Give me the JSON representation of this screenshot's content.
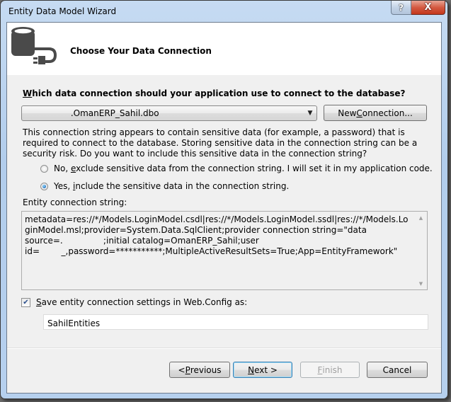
{
  "window": {
    "title": "Entity Data Model Wizard",
    "help_label": "?",
    "close_label": "X"
  },
  "header": {
    "icon": "database-connection-icon",
    "title": "Choose Your Data Connection"
  },
  "connection": {
    "question_accesskey": "W",
    "question_rest": "hich data connection should your application use to connect to the database?",
    "selected_value": "                 .OmanERP_Sahil.dbo",
    "dropdown_icon": "chevron-down-icon",
    "new_connection_prefix": "New ",
    "new_connection_accesskey": "C",
    "new_connection_rest": "onnection..."
  },
  "sensitive": {
    "info": "This connection string appears to contain sensitive data (for example, a password) that is required to connect to the database. Storing sensitive data in the connection string can be a security risk. Do you want to include this sensitive data in the connection string?",
    "options": [
      {
        "prefix": "No, ",
        "accesskey": "e",
        "rest": "xclude sensitive data from the connection string. I will set it in my application code.",
        "checked": false
      },
      {
        "prefix": "Yes, ",
        "accesskey": "i",
        "rest": "nclude the sensitive data in the connection string.",
        "checked": true
      }
    ]
  },
  "entity_connection": {
    "label": "Entity connection string:",
    "value": "metadata=res://*/Models.LoginModel.csdl|res://*/Models.LoginModel.ssdl|res://*/Models.LoginModel.msl;provider=System.Data.SqlClient;provider connection string=\"data source=.               ;initial catalog=OmanERP_Sahil;user id=        _,password=***********;MultipleActiveResultSets=True;App=EntityFramework\""
  },
  "save_settings": {
    "checked": true,
    "accesskey": "S",
    "rest": "ave entity connection settings in Web.Config as:",
    "name_value": "SahilEntities"
  },
  "footer": {
    "previous_prefix": "< ",
    "previous_accesskey": "P",
    "previous_rest": "revious",
    "next_accesskey": "N",
    "next_rest": "ext >",
    "finish_accesskey": "F",
    "finish_rest": "inish",
    "cancel_label": "Cancel"
  }
}
